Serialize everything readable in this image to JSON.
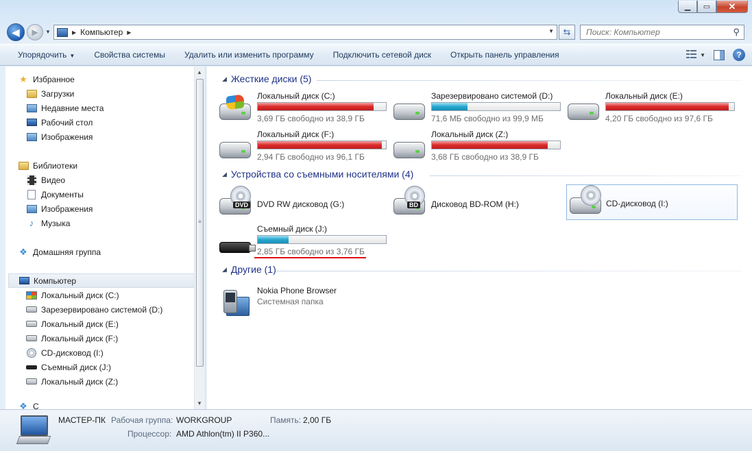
{
  "window": {
    "minimize_glyph": "▁",
    "maximize_glyph": "▭",
    "close_glyph": "✕"
  },
  "nav": {
    "back_glyph": "◀",
    "forward_glyph": "▶",
    "address_segments": [
      "Компьютер"
    ],
    "search_placeholder": "Поиск: Компьютер"
  },
  "toolbar": {
    "items": [
      {
        "label": "Упорядочить",
        "has_dropdown": true
      },
      {
        "label": "Свойства системы"
      },
      {
        "label": "Удалить или изменить программу"
      },
      {
        "label": "Подключить сетевой диск"
      },
      {
        "label": "Открыть панель управления"
      }
    ],
    "help_glyph": "?"
  },
  "sidebar": {
    "favorites": {
      "title": "Избранное",
      "items": [
        "Загрузки",
        "Недавние места",
        "Рабочий стол",
        "Изображения"
      ]
    },
    "libraries": {
      "title": "Библиотеки",
      "items": [
        "Видео",
        "Документы",
        "Изображения",
        "Музыка"
      ]
    },
    "homegroup": "Домашняя группа",
    "computer": {
      "title": "Компьютер",
      "items": [
        "Локальный диск (C:)",
        "Зарезервировано системой (D:)",
        "Локальный диск (E:)",
        "Локальный диск (F:)",
        "CD-дисковод (I:)",
        "Съемный диск (J:)",
        "Локальный диск (Z:)"
      ]
    },
    "partial_item": "С"
  },
  "groups": {
    "hard_disks": {
      "title": "Жесткие диски (5)",
      "drives": [
        {
          "name": "Локальный диск (C:)",
          "free": "3,69 ГБ свободно из 38,9 ГБ",
          "used_fraction": 0.905,
          "bar_color": "red",
          "icon": "windows-drive-icon"
        },
        {
          "name": "Зарезервировано системой (D:)",
          "free": "71,6 МБ свободно из 99,9 МБ",
          "used_fraction": 0.28,
          "bar_color": "blue",
          "icon": "hard-drive-icon"
        },
        {
          "name": "Локальный диск (E:)",
          "free": "4,20 ГБ свободно из 97,6 ГБ",
          "used_fraction": 0.957,
          "bar_color": "red",
          "icon": "hard-drive-icon"
        },
        {
          "name": "Локальный диск (F:)",
          "free": "2,94 ГБ свободно из 96,1 ГБ",
          "used_fraction": 0.969,
          "bar_color": "red",
          "icon": "hard-drive-icon"
        },
        {
          "name": "Локальный диск (Z:)",
          "free": "3,68 ГБ свободно из 38,9 ГБ",
          "used_fraction": 0.905,
          "bar_color": "red",
          "icon": "hard-drive-icon"
        }
      ]
    },
    "removable": {
      "title": "Устройства со съемными носителями (4)",
      "devices": [
        {
          "name": "DVD RW дисковод (G:)",
          "badge": "DVD",
          "icon": "dvd-drive-icon"
        },
        {
          "name": "Дисковод BD-ROM (H:)",
          "badge": "BD",
          "icon": "bd-drive-icon"
        },
        {
          "name": "CD-дисковод (I:)",
          "badge": "",
          "icon": "cd-drive-icon"
        },
        {
          "name": "Съемный диск (J:)",
          "free": "2,85 ГБ свободно из 3,76 ГБ",
          "used_fraction": 0.242,
          "bar_color": "blue",
          "icon": "usb-drive-icon"
        }
      ]
    },
    "other": {
      "title": "Другие (1)",
      "items": [
        {
          "name": "Nokia Phone Browser",
          "subtitle": "Системная папка",
          "icon": "system-folder-icon"
        }
      ]
    }
  },
  "details": {
    "computer_name": "МАСТЕР-ПК",
    "workgroup_label": "Рабочая группа:",
    "workgroup_value": "WORKGROUP",
    "memory_label": "Память:",
    "memory_value": "2,00 ГБ",
    "cpu_label": "Процессор:",
    "cpu_value": "AMD Athlon(tm) II P360..."
  },
  "colors": {
    "bar_red": "#da2b2b",
    "bar_blue": "#27a7cf",
    "group_header": "#1e3287",
    "annotation_red": "#e01010"
  }
}
